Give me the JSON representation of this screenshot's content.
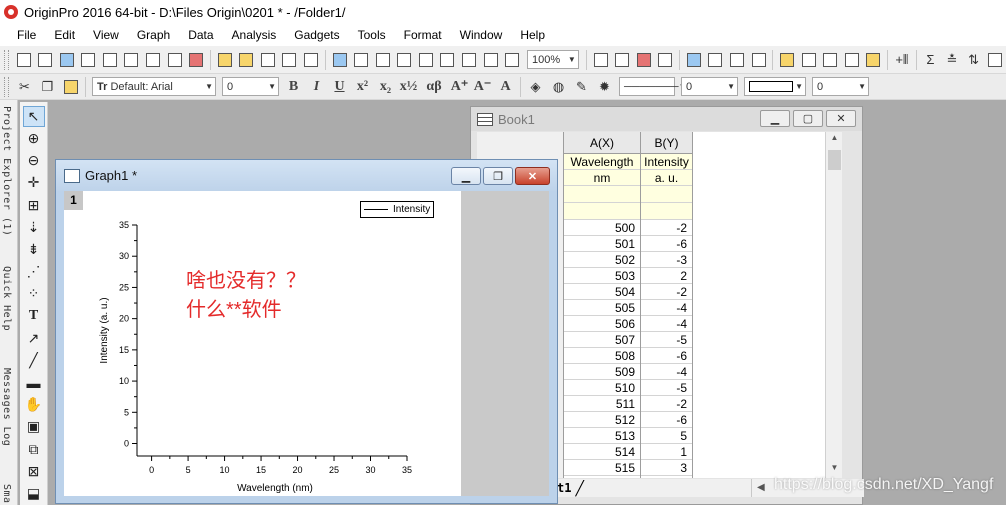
{
  "window": {
    "title": "OriginPro 2016 64-bit - D:\\Files Origin\\0201 * - /Folder1/"
  },
  "menu": [
    "File",
    "Edit",
    "View",
    "Graph",
    "Data",
    "Analysis",
    "Gadgets",
    "Tools",
    "Format",
    "Window",
    "Help"
  ],
  "toolbar1": {
    "zoom": "100%"
  },
  "toolbar2": {
    "font_label": "Default: Arial",
    "font_size": "0",
    "line_width": "0",
    "border_width": "0"
  },
  "sidetabs": [
    "Project Explorer (1)",
    "Quick Help",
    "Messages Log",
    "Sma"
  ],
  "tools": [
    "pointer-icon",
    "zoom-in-icon",
    "zoom-out-icon",
    "crosshair-icon",
    "scale-icon",
    "reader-icon",
    "data-selector-icon",
    "region-icon",
    "mask-icon",
    "text-icon",
    "arrow-icon",
    "line-icon",
    "rectangle-icon",
    "hand-icon",
    "insert-graph-icon",
    "draw-data-icon",
    "add-layer-icon",
    "object-icon"
  ],
  "book": {
    "title": "Book1",
    "columns": [
      {
        "header": "A(X)",
        "long_name": "Wavelength",
        "units": "nm"
      },
      {
        "header": "B(Y)",
        "long_name": "Intensity",
        "units": "a. u."
      }
    ],
    "rows": [
      [
        "500",
        "-2"
      ],
      [
        "501",
        "-6"
      ],
      [
        "502",
        "-3"
      ],
      [
        "503",
        "2"
      ],
      [
        "504",
        "-2"
      ],
      [
        "505",
        "-4"
      ],
      [
        "506",
        "-4"
      ],
      [
        "507",
        "-5"
      ],
      [
        "508",
        "-6"
      ],
      [
        "509",
        "-4"
      ],
      [
        "510",
        "-5"
      ],
      [
        "511",
        "-2"
      ],
      [
        "512",
        "-6"
      ],
      [
        "513",
        "5"
      ],
      [
        "514",
        "1"
      ],
      [
        "515",
        "3"
      ]
    ],
    "sheet_tab": "t1"
  },
  "graph": {
    "title": "Graph1 *",
    "layer": "1",
    "legend": "Intensity",
    "annotation_line1": "啥也没有？？",
    "annotation_line2": "什么**软件",
    "annotation_color": "#e42a2a"
  },
  "chart_data": {
    "type": "line",
    "title": "",
    "xlabel": "Wavelength (nm)",
    "ylabel": "Intensity (a. u.)",
    "xlim": [
      -2,
      35
    ],
    "ylim": [
      -2,
      35
    ],
    "xticks": [
      0,
      5,
      10,
      15,
      20,
      25,
      30,
      35
    ],
    "yticks": [
      0,
      5,
      10,
      15,
      20,
      25,
      30,
      35
    ],
    "series": [
      {
        "name": "Intensity",
        "x": [],
        "y": []
      }
    ],
    "grid": false,
    "legend_position": "top-right"
  },
  "watermark": "https://blog.csdn.net/XD_Yangf"
}
